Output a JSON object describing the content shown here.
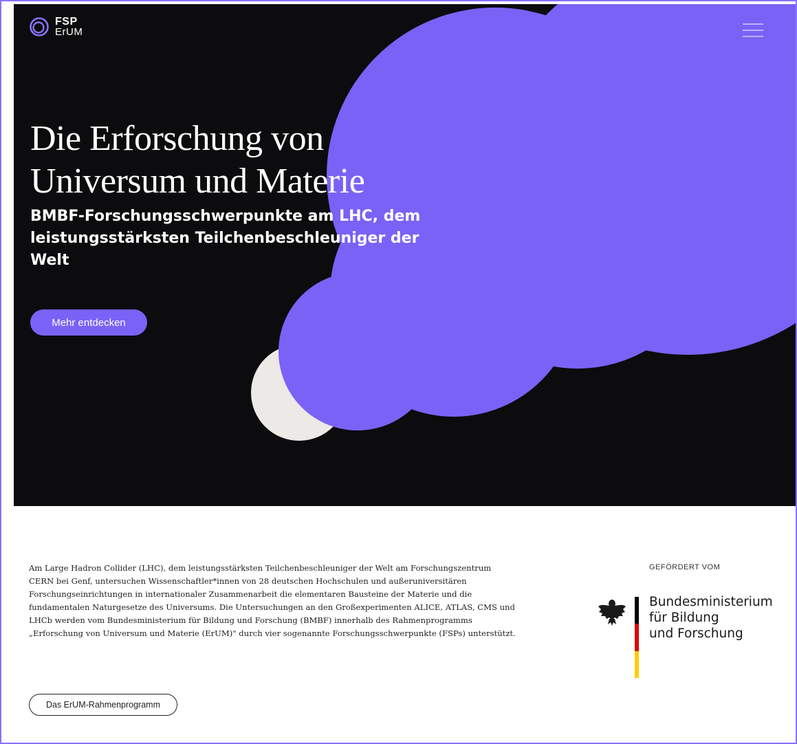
{
  "header": {
    "logo_line1": "FSP",
    "logo_line2": "ErUM",
    "menu_icon": "hamburger-menu-icon"
  },
  "hero": {
    "title_line1": "Die Erforschung von",
    "title_line2": "Universum und Materie",
    "subtitle_line1": "BMBF-Forschungsschwerpunkte am LHC, dem",
    "subtitle_line2": "leistungsstärksten Teilchenbeschleuniger der",
    "subtitle_line3": "Welt",
    "cta_label": "Mehr entdecken"
  },
  "intro": {
    "text": "Am Large Hadron Collider (LHC), dem leistungsstärksten Teilchenbeschleuniger der Welt am Forschungszentrum CERN bei Genf, untersuchen Wissenschaftler*innen von 28 deutschen Hochschulen und außeruniversitären Forschungseinrichtungen in internationaler Zusammenarbeit die elementaren Bausteine der Materie und die fundamentalen Naturgesetze des Universums. Die Untersuchungen an den Großexperimenten ALICE, ATLAS, CMS und LHCb werden vom Bundesministerium für Bildung und Forschung (BMBF) innerhalb des Rahmenprogramms „Erforschung von Universum und Materie (ErUM)\" durch vier sogenannte Forschungsschwerpunkte (FSPs) unterstützt.",
    "button_label": "Das ErUM-Rahmenprogramm"
  },
  "funding": {
    "label": "GEFÖRDERT VOM",
    "line1": "Bundesministerium",
    "line2": "für Bildung",
    "line3": "und Forschung"
  },
  "colors": {
    "accent": "#7b62f6",
    "hero_bg": "#0c0b0d",
    "circle": "#ece9e6"
  }
}
